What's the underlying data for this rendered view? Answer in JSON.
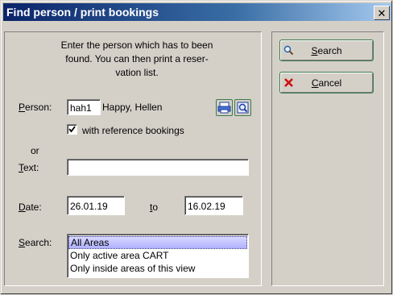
{
  "window": {
    "title": "Find person / print bookings",
    "close_glyph": "✕"
  },
  "form": {
    "intro_line1": "Enter the person which has to been",
    "intro_line2": "found. You can then print a reser-",
    "intro_line3": "vation list.",
    "person_label": "Person:",
    "person_code": "hah1",
    "person_name": "Happy, Hellen",
    "reference_checked": true,
    "reference_label": "with reference bookings",
    "or_label": "or",
    "text_label": "Text:",
    "text_value": "",
    "date_label": "Date:",
    "date_from": "26.01.19",
    "to_label": "to",
    "date_to": "16.02.19",
    "search_label": "Search:",
    "search_options": [
      "All Areas",
      "Only active area CART",
      "Only inside areas of this view"
    ],
    "search_selected_index": 0
  },
  "actions": {
    "search_label": "Search",
    "cancel_label": "Cancel"
  },
  "icons": {
    "print_button": "print-icon",
    "preview_button": "preview-icon",
    "search_button": "magnifier-icon",
    "cancel_button": "cancel-x-icon"
  },
  "colors": {
    "title_start": "#0a246a",
    "title_end": "#a6caf0",
    "face": "#d4d0c8",
    "button_border": "#3a7a4a",
    "cancel_red": "#d01010",
    "selection": "#b0b0ff"
  }
}
